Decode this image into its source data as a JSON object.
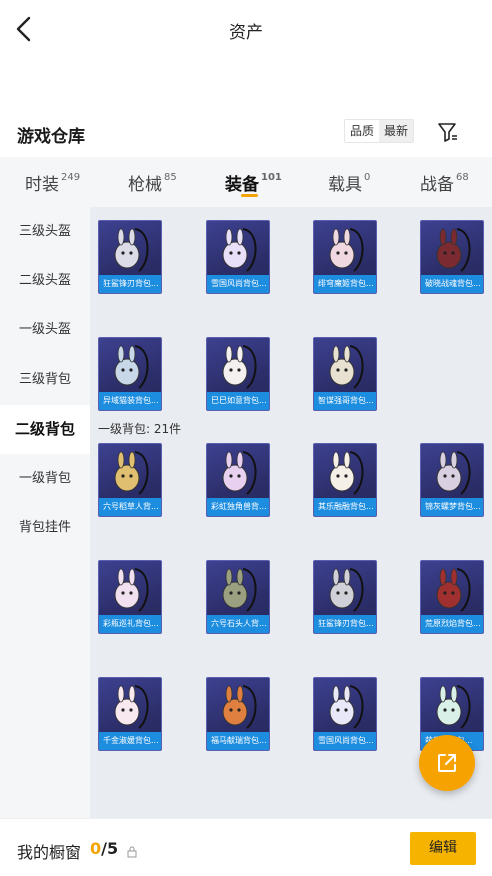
{
  "header": {
    "title": "资产"
  },
  "warehouse": {
    "title": "游戏仓库",
    "sort_options": [
      "品质",
      "最新"
    ]
  },
  "tabs": [
    {
      "label": "时装",
      "count": "249"
    },
    {
      "label": "枪械",
      "count": "85"
    },
    {
      "label": "装备",
      "count": "101"
    },
    {
      "label": "载具",
      "count": "0"
    },
    {
      "label": "战备",
      "count": "68"
    }
  ],
  "sidebar": {
    "items": [
      "三级头盔",
      "二级头盔",
      "一级头盔",
      "三级背包",
      "二级背包",
      "一级背包",
      "背包挂件"
    ]
  },
  "items": [
    {
      "label": "狂鲨锋刃背包..."
    },
    {
      "label": "雪国风尚背包..."
    },
    {
      "label": "绯穹魔姬背包..."
    },
    {
      "label": "破晓战魂背包..."
    },
    {
      "label": "异域猫装背包..."
    },
    {
      "label": "巳巳如意背包..."
    },
    {
      "label": "智谋强哥背包..."
    },
    {
      "label": "六号稻草人背..."
    },
    {
      "label": "彩虹独角兽背..."
    },
    {
      "label": "其乐融融背包..."
    },
    {
      "label": "锦灰螺梦背包..."
    },
    {
      "label": "彩瓶巡礼背包..."
    },
    {
      "label": "六号石头人背..."
    },
    {
      "label": "狂鲨锋刃背包..."
    },
    {
      "label": "荒原烈焰背包..."
    },
    {
      "label": "千金淑媛背包..."
    },
    {
      "label": "福马献瑞背包..."
    },
    {
      "label": "雪国风尚背包..."
    },
    {
      "label": "萌趣...背包..."
    }
  ],
  "group_label": "一级背包: 21件",
  "bottom": {
    "showcase_label": "我的橱窗",
    "showcase_current": "0",
    "showcase_total": "/5",
    "edit_label": "编辑"
  },
  "colors": {
    "accent": "#f6b400",
    "label_bg": "#1d8de0",
    "card_bg": "#2c2e6a"
  }
}
